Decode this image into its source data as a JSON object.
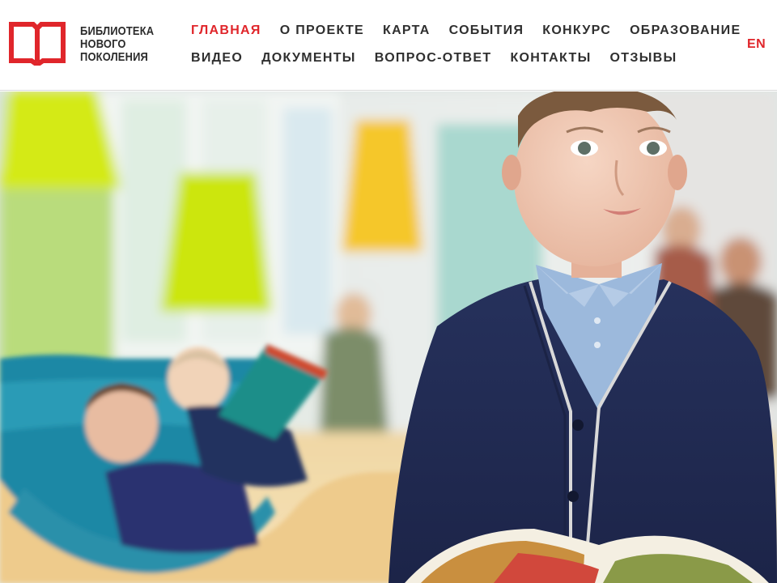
{
  "logo": {
    "lines": [
      "БИБЛИОТЕКА",
      "НОВОГО",
      "ПОКОЛЕНИЯ"
    ],
    "mark_icon": "open-book-icon",
    "brand_color": "#e0262b"
  },
  "nav": {
    "row1": [
      {
        "label": "ГЛАВНАЯ",
        "active": true
      },
      {
        "label": "О ПРОЕКТЕ",
        "active": false
      },
      {
        "label": "КАРТА",
        "active": false
      },
      {
        "label": "СОБЫТИЯ",
        "active": false
      },
      {
        "label": "КОНКУРС",
        "active": false
      },
      {
        "label": "ОБРАЗОВАНИЕ",
        "active": false
      }
    ],
    "row2": [
      {
        "label": "ВИДЕО",
        "active": false
      },
      {
        "label": "ДОКУМЕНТЫ",
        "active": false
      },
      {
        "label": "ВОПРОС-ОТВЕТ",
        "active": false
      },
      {
        "label": "КОНТАКТЫ",
        "active": false
      },
      {
        "label": "ОТЗЫВЫ",
        "active": false
      }
    ],
    "active_color": "#e0262b",
    "text_color": "#2f2f2f"
  },
  "lang_switch": {
    "label": "EN"
  },
  "hero": {
    "image_subject": "children-reading-in-library-photo"
  }
}
